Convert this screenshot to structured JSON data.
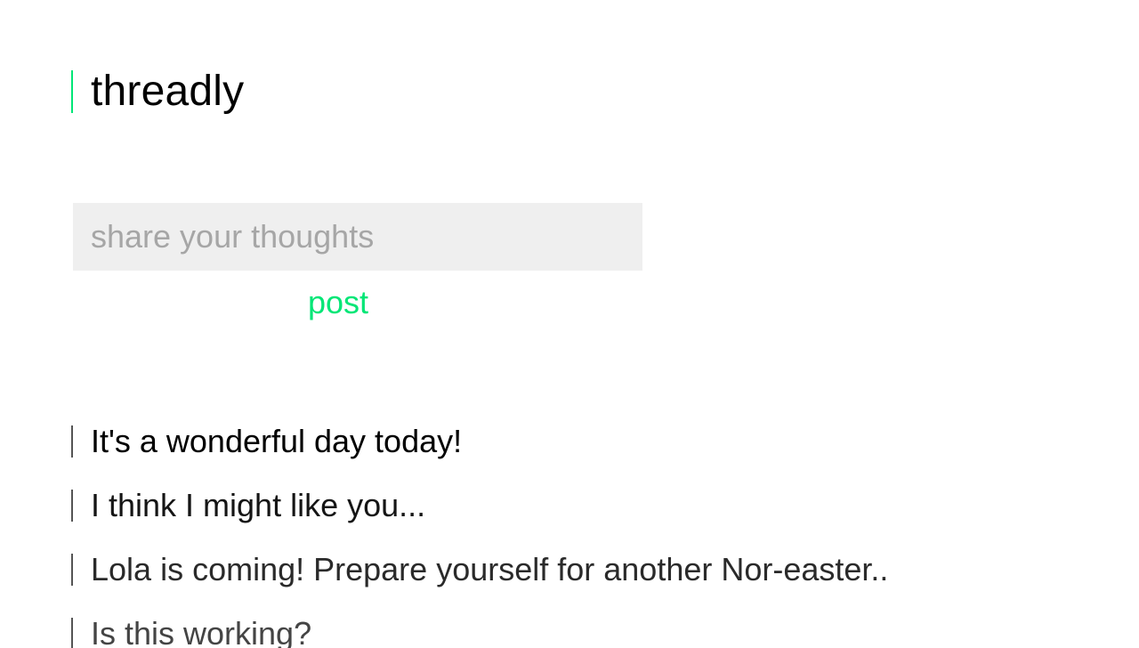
{
  "app": {
    "title": "threadly"
  },
  "composer": {
    "placeholder": "share your thoughts",
    "value": "",
    "post_label": "post"
  },
  "threads": [
    {
      "text": "It's a wonderful day today!"
    },
    {
      "text": "I think I might like you..."
    },
    {
      "text": "Lola is coming! Prepare yourself for another Nor-easter.."
    },
    {
      "text": "Is this working?"
    }
  ],
  "colors": {
    "accent": "#00e676",
    "input_background": "#efefef",
    "placeholder": "#a6a6a6",
    "thread_bar": "#555555"
  }
}
